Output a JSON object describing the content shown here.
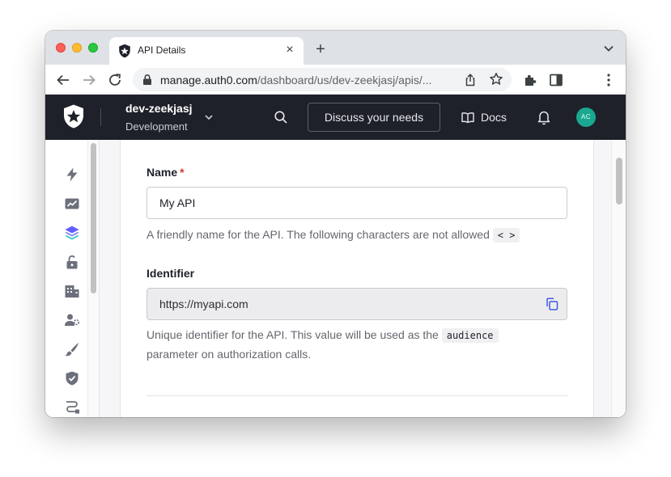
{
  "browser": {
    "tab_title": "API Details",
    "tab_close": "×",
    "new_tab": "+",
    "url_host": "manage.auth0.com",
    "url_path": "/dashboard/us/dev-zeekjasj/apis/..."
  },
  "header": {
    "tenant_name": "dev-zeekjasj",
    "tenant_env": "Development",
    "discuss_label": "Discuss your needs",
    "docs_label": "Docs",
    "avatar_initials": "AC"
  },
  "form": {
    "name_label": "Name",
    "required_mark": "*",
    "name_value": "My API",
    "name_help": "A friendly name for the API. The following characters are not allowed",
    "name_help_code": "< >",
    "identifier_label": "Identifier",
    "identifier_value": "https://myapi.com",
    "identifier_help_1": "Unique identifier for the API. This value will be used as the",
    "identifier_help_code": "audience",
    "identifier_help_2": "parameter on authorization calls."
  },
  "colors": {
    "accent": "#3f59e4",
    "avatar": "#1aa890",
    "header_bg": "#1e212a",
    "required": "#d03c38"
  }
}
